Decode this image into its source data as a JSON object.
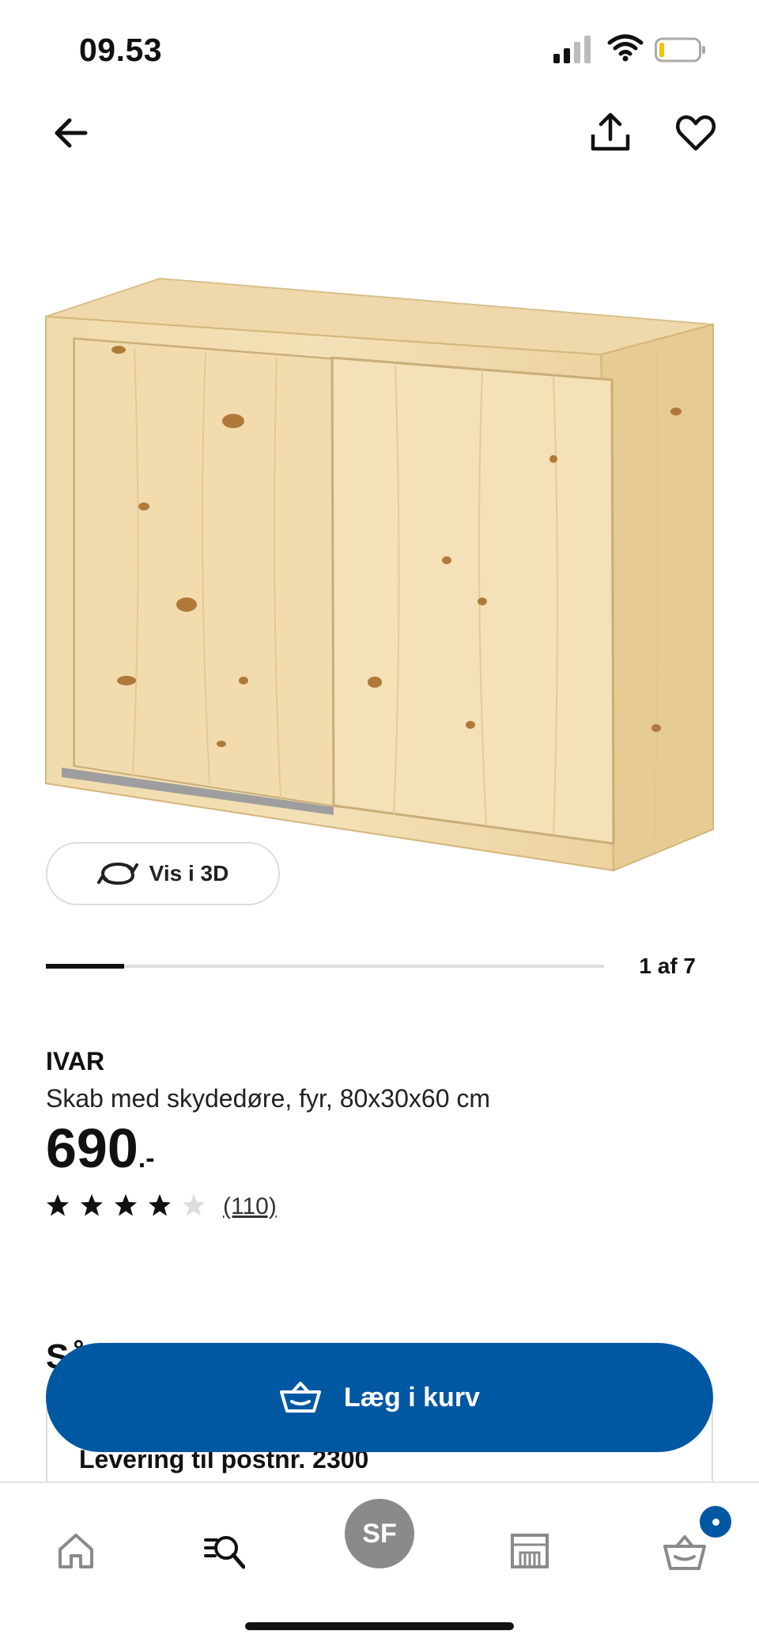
{
  "status_bar": {
    "time": "09.53"
  },
  "gallery": {
    "view_3d_label": "Vis i 3D",
    "position_label": "1 af 7",
    "progress": 0.14
  },
  "product": {
    "brand": "IVAR",
    "description": "Skab med skydedøre, fyr, 80x30x60 cm",
    "price": "690",
    "price_suffix": ".-",
    "rating": 4,
    "rating_max": 5,
    "review_count": "(110)"
  },
  "section": {
    "title_cut": "Så"
  },
  "delivery": {
    "label": "Levering til postnr. 2300"
  },
  "cta": {
    "add_to_cart": "Læg i kurv"
  },
  "bottom_nav": {
    "avatar_initials": "SF"
  },
  "colors": {
    "brand_blue": "#0058a3",
    "star_filled": "#111111",
    "star_empty": "#dddddd"
  },
  "icons": [
    "back-arrow-icon",
    "share-icon",
    "heart-icon",
    "rotate-3d-icon",
    "basket-icon",
    "home-icon",
    "search-list-icon",
    "store-icon",
    "cart-icon"
  ]
}
